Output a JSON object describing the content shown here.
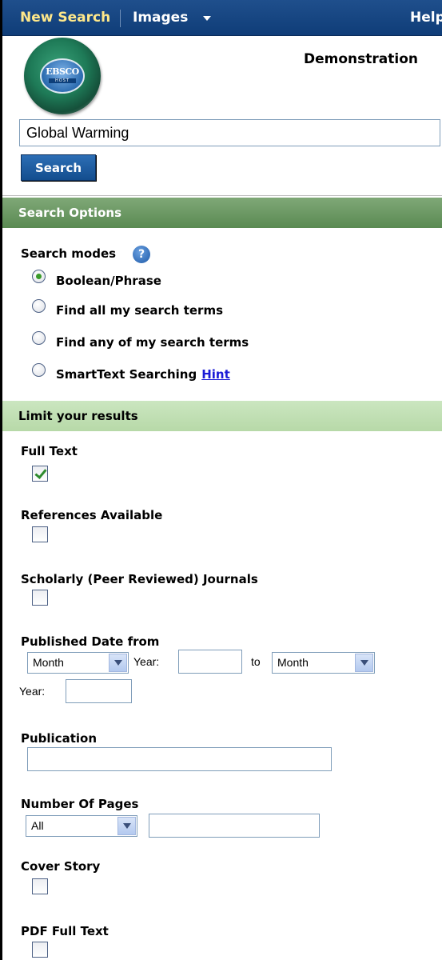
{
  "topbar": {
    "new_search": "New Search",
    "images": "Images",
    "help": "Help"
  },
  "logo": {
    "text": "EBSCO",
    "sub": "HOST"
  },
  "header": {
    "demo": "Demonstration"
  },
  "search": {
    "value": "Global Warming",
    "button": "Search"
  },
  "search_options": {
    "title": "Search Options",
    "modes_label": "Search modes",
    "help_glyph": "?",
    "modes": [
      {
        "label": "Boolean/Phrase",
        "checked": true
      },
      {
        "label": "Find all my search terms",
        "checked": false
      },
      {
        "label": "Find any of my search terms",
        "checked": false
      },
      {
        "label": "SmartText Searching",
        "checked": false
      }
    ],
    "hint": "Hint"
  },
  "limits": {
    "title": "Limit your results",
    "full_text": "Full Text",
    "references": "References Available",
    "scholarly": "Scholarly (Peer Reviewed) Journals",
    "published_date": "Published Date from",
    "month_from": "Month",
    "year_label": "Year:",
    "to": "to",
    "month_to": "Month",
    "year_label_2": "Year:",
    "publication": "Publication",
    "num_pages": "Number Of Pages",
    "pages_option": "All",
    "cover_story": "Cover Story",
    "pdf_full_text": "PDF Full Text"
  },
  "colors": {
    "nav_bg": "#1f4f8c",
    "options_bg": "#5a8a52",
    "limit_bg": "#b7d9a8",
    "link": "#1a1ad6"
  }
}
